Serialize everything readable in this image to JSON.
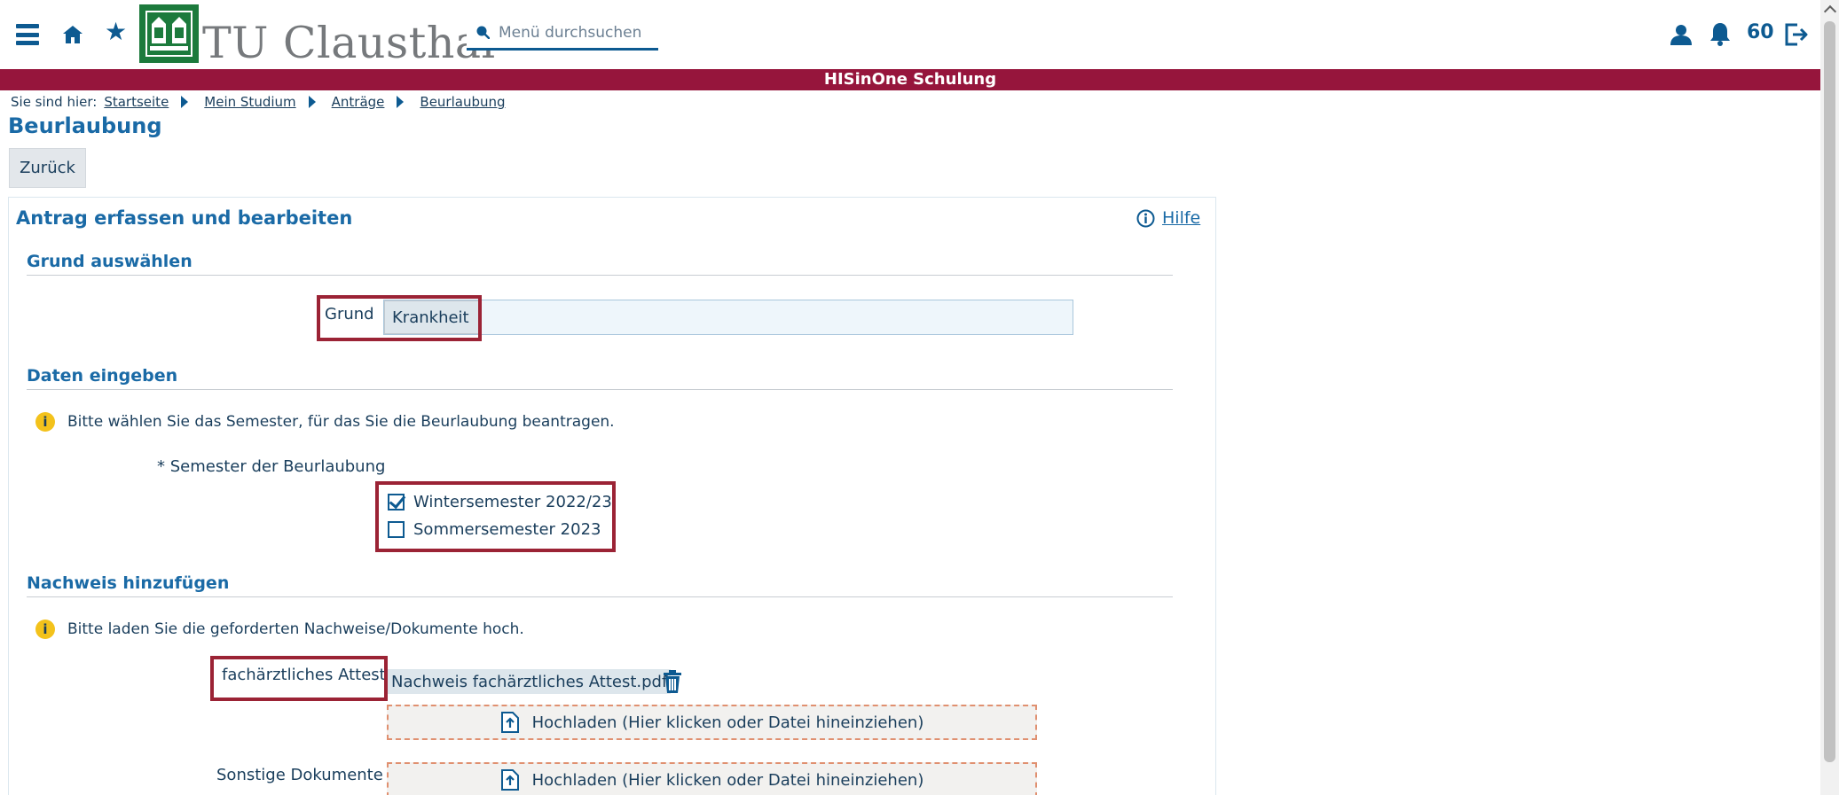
{
  "header": {
    "logo_text": "TU Clausthal",
    "logo_mark": "university-crest",
    "search_placeholder": "Menü durchsuchen",
    "notification_count": "60",
    "icons": [
      "menu-icon",
      "home-icon",
      "star-icon",
      "search-icon",
      "user-icon",
      "bell-icon",
      "logout-icon"
    ]
  },
  "banner": {
    "text": "HISinOne Schulung",
    "color": "#96153c"
  },
  "breadcrumb": {
    "lead": "Sie sind hier:",
    "items": [
      "Startseite",
      "Mein Studium",
      "Anträge",
      "Beurlaubung"
    ]
  },
  "page": {
    "title": "Beurlaubung",
    "back_label": "Zurück"
  },
  "panel": {
    "title": "Antrag erfassen und bearbeiten",
    "help_label": "Hilfe",
    "sections": {
      "grund": {
        "heading": "Grund auswählen",
        "field_label": "Grund",
        "selected_value": "Krankheit"
      },
      "daten": {
        "heading": "Daten eingeben",
        "hint": "Bitte wählen Sie das Semester, für das Sie die Beurlaubung beantragen.",
        "semester_label": "* Semester der Beurlaubung",
        "options": [
          {
            "label": "Wintersemester 2022/23",
            "checked": true
          },
          {
            "label": "Sommersemester 2023",
            "checked": false
          }
        ]
      },
      "nachweis": {
        "heading": "Nachweis hinzufügen",
        "hint": "Bitte laden Sie die geforderten Nachweise/Dokumente hoch.",
        "attest_label": "fachärztliches Attest",
        "attest_file": "Nachweis fachärztliches Attest.pdf",
        "upload_label": "Hochladen (Hier klicken oder Datei hineinziehen)",
        "other_label": "Sonstige Dokumente"
      }
    }
  },
  "colors": {
    "primary": "#0d5a91",
    "heading": "#1a6aa6",
    "annotation": "#9b2335",
    "warning": "#f3c21b",
    "logo_green": "#1c7a3c"
  }
}
